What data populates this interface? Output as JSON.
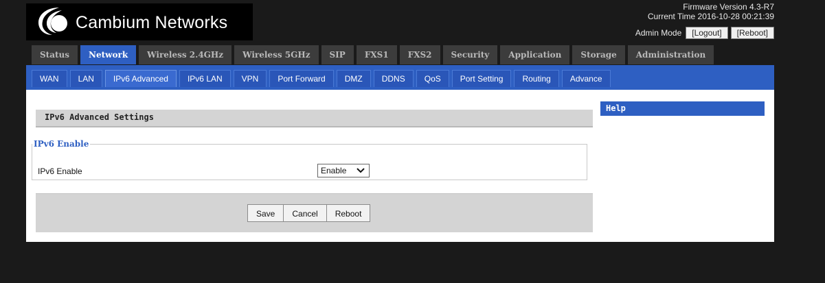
{
  "brand": {
    "name": "Cambium Networks"
  },
  "header": {
    "firmware": "Firmware Version 4.3-R7",
    "current_time": "Current Time 2016-10-28 00:21:39",
    "admin_mode": "Admin Mode",
    "logout": "[Logout]",
    "reboot": "[Reboot]"
  },
  "main_tabs": [
    {
      "label": "Status",
      "active": false
    },
    {
      "label": "Network",
      "active": true
    },
    {
      "label": "Wireless 2.4GHz",
      "active": false
    },
    {
      "label": "Wireless 5GHz",
      "active": false
    },
    {
      "label": "SIP",
      "active": false
    },
    {
      "label": "FXS1",
      "active": false
    },
    {
      "label": "FXS2",
      "active": false
    },
    {
      "label": "Security",
      "active": false
    },
    {
      "label": "Application",
      "active": false
    },
    {
      "label": "Storage",
      "active": false
    },
    {
      "label": "Administration",
      "active": false
    }
  ],
  "sub_tabs": [
    {
      "label": "WAN",
      "active": false
    },
    {
      "label": "LAN",
      "active": false
    },
    {
      "label": "IPv6 Advanced",
      "active": true
    },
    {
      "label": "IPv6 LAN",
      "active": false
    },
    {
      "label": "VPN",
      "active": false
    },
    {
      "label": "Port Forward",
      "active": false
    },
    {
      "label": "DMZ",
      "active": false
    },
    {
      "label": "DDNS",
      "active": false
    },
    {
      "label": "QoS",
      "active": false
    },
    {
      "label": "Port Setting",
      "active": false
    },
    {
      "label": "Routing",
      "active": false
    },
    {
      "label": "Advance",
      "active": false
    }
  ],
  "content": {
    "section_title": "IPv6 Advanced Settings",
    "help_title": "Help",
    "group_legend": "IPv6 Enable",
    "field_label": "IPv6 Enable",
    "field_value": "Enable",
    "buttons": {
      "save": "Save",
      "cancel": "Cancel",
      "reboot": "Reboot"
    }
  },
  "colors": {
    "accent": "#2e5fc2",
    "tab_bg": "#3c3c3c",
    "panel_gray": "#d4d4d4"
  }
}
